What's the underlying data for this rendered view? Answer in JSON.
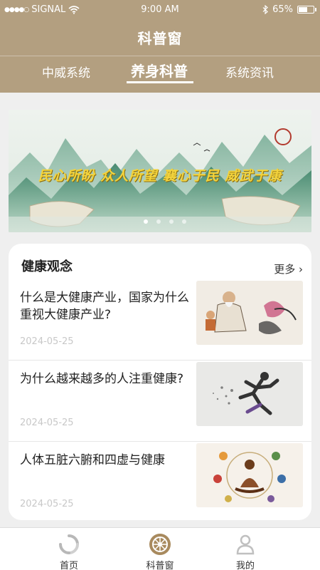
{
  "status_bar": {
    "signal": "SIGNAL",
    "time": "9:00 AM",
    "battery": "65%",
    "battery_level": 0.65
  },
  "header": {
    "title": "科普窗",
    "tabs": [
      {
        "label": "中威系统",
        "active": false
      },
      {
        "label": "养身科普",
        "active": true
      },
      {
        "label": "系统资讯",
        "active": false
      }
    ],
    "background_color": "#b39f80"
  },
  "banner": {
    "slogan": "民心所盼 众人所望 襄心于民 威武于康",
    "slide_count": 4,
    "active_slide": 1
  },
  "section": {
    "title": "健康观念",
    "more_label": "更多",
    "articles": [
      {
        "title": "什么是大健康产业，国家为什么重视大健康产业?",
        "date": "2024-05-25",
        "image": "sage-with-child-ink-painting"
      },
      {
        "title": "为什么越来越多的人注重健康?",
        "date": "2024-05-25",
        "image": "sprinting-runner-ink-splash"
      },
      {
        "title": "人体五脏六腑和四虚与健康",
        "date": "2024-05-25",
        "image": "meditation-organ-diagram"
      }
    ]
  },
  "bottom_nav": {
    "items": [
      {
        "label": "首页",
        "icon": "home-icon",
        "active": false
      },
      {
        "label": "科普窗",
        "icon": "dharma-wheel-icon",
        "active": true
      },
      {
        "label": "我的",
        "icon": "user-icon",
        "active": false
      }
    ]
  }
}
